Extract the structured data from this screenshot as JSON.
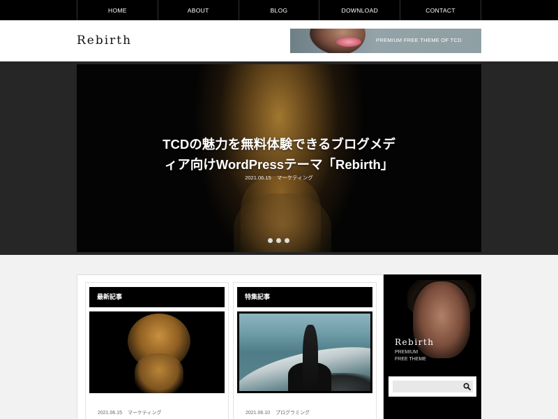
{
  "nav": {
    "items": [
      {
        "label": "HOME"
      },
      {
        "label": "ABOUT"
      },
      {
        "label": "BLOG"
      },
      {
        "label": "DOWNLOAD"
      },
      {
        "label": "CONTACT"
      }
    ]
  },
  "header": {
    "logo": "Rebirth",
    "banner_text": "PREMIUM FREE THEME OF TCD"
  },
  "hero": {
    "title_line1": "TCDの魅力を無料体験できるブログメデ",
    "title_line2": "ィア向けWordPressテーマ「Rebirth」",
    "date": "2021.06.15",
    "category": "マーケティング",
    "slider_dots": 3
  },
  "columns": [
    {
      "heading": "最新記事",
      "date": "2021.06.15",
      "category": "マーケティング"
    },
    {
      "heading": "特集記事",
      "date": "2021.06.10",
      "category": "プログラミング"
    }
  ],
  "sidebar": {
    "ad_logo": "Rebirth",
    "ad_sub_line1": "PREMIUM",
    "ad_sub_line2": "FREE THEME",
    "search_placeholder": ""
  },
  "icons": {
    "search": "search-icon"
  },
  "colors": {
    "nav_bg": "#000000",
    "hero_band": "#262626",
    "page_bg": "#f2f2f2"
  }
}
